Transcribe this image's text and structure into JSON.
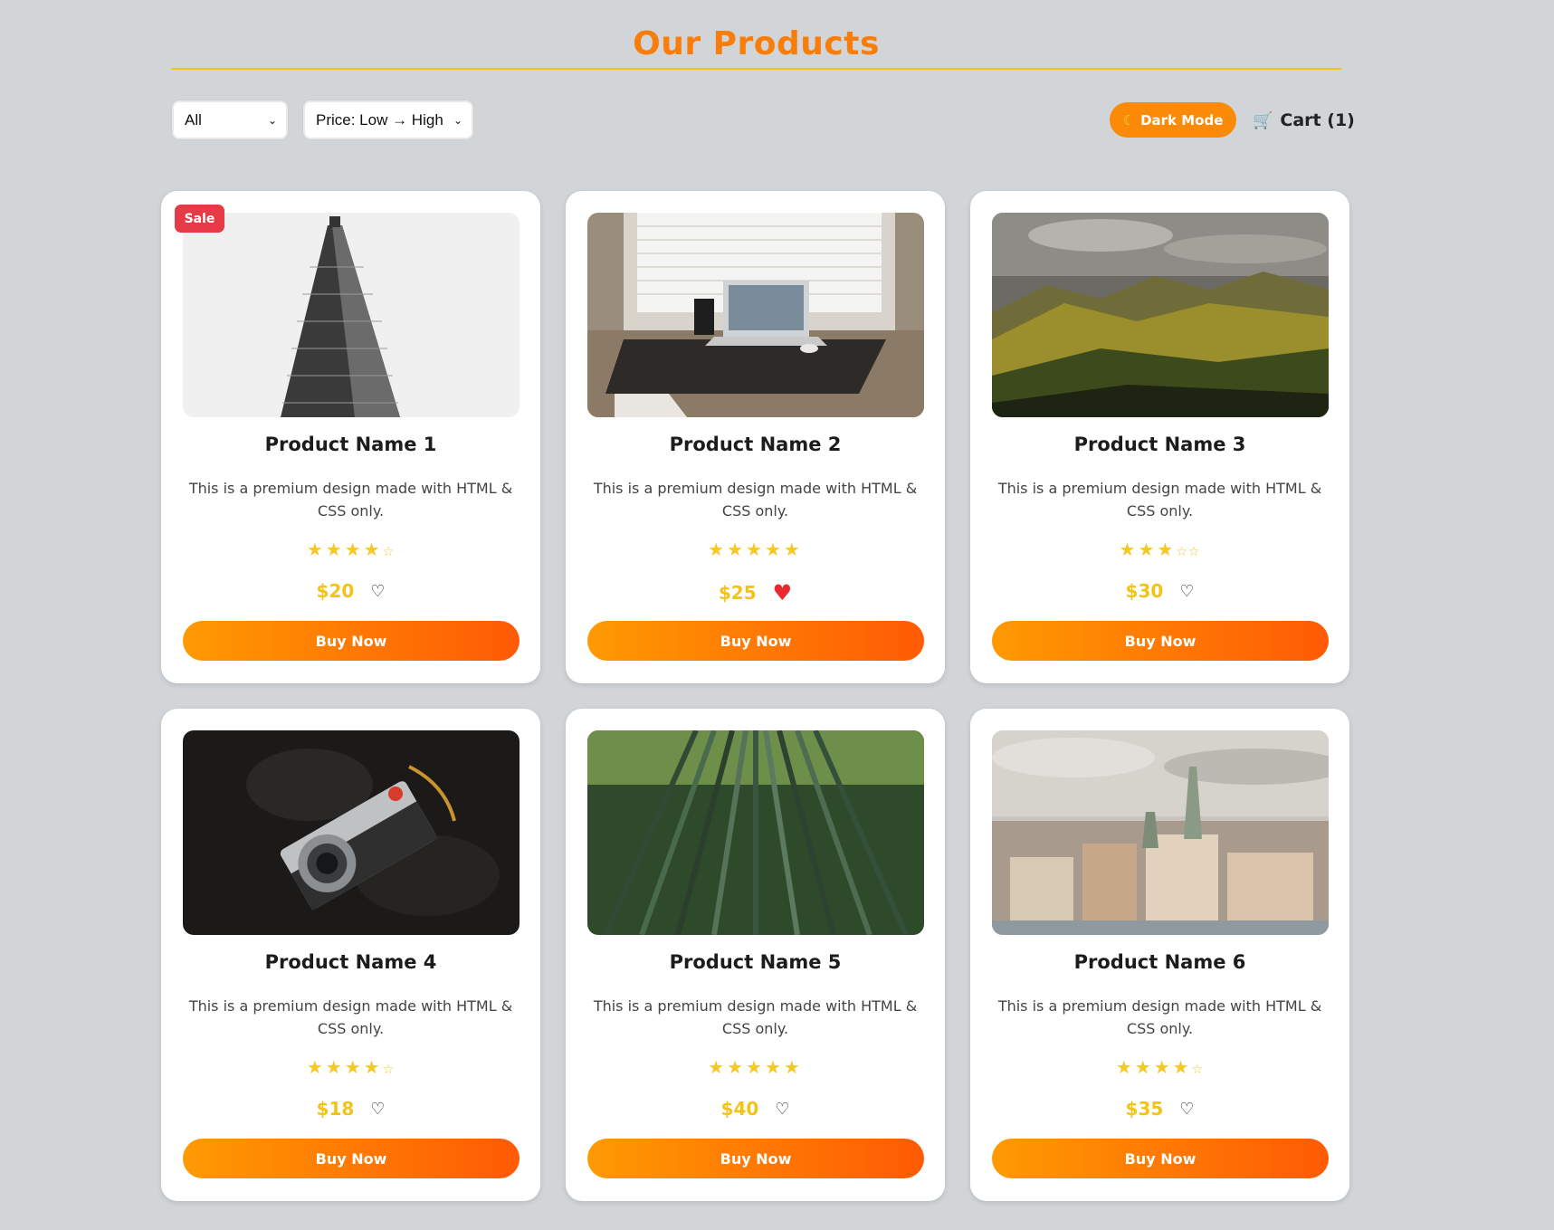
{
  "header": {
    "title": "Our Products"
  },
  "toolbar": {
    "category_value": "All",
    "sort_value": "Price: Low → High",
    "dark_mode_label": "Dark Mode",
    "cart_label": "Cart (1)"
  },
  "colors": {
    "accent": "#f97d0b",
    "price": "#f2c418",
    "sale": "#e63b47",
    "star": "#f6c825",
    "button_start": "#ff9a02",
    "button_end": "#ff5a05"
  },
  "products": [
    {
      "name": "Product Name 1",
      "desc": "This is a premium design made with HTML & CSS only.",
      "price": "$20",
      "rating": 4,
      "badge": "Sale",
      "favorite": false,
      "buy_label": "Buy Now",
      "image": "flatiron-building"
    },
    {
      "name": "Product Name 2",
      "desc": "This is a premium design made with HTML & CSS only.",
      "price": "$25",
      "rating": 5,
      "favorite": true,
      "buy_label": "Buy Now",
      "image": "laptop-desk"
    },
    {
      "name": "Product Name 3",
      "desc": "This is a premium design made with HTML & CSS only.",
      "price": "$30",
      "rating": 3,
      "favorite": false,
      "buy_label": "Buy Now",
      "image": "mountain-valley"
    },
    {
      "name": "Product Name 4",
      "desc": "This is a premium design made with HTML & CSS only.",
      "price": "$18",
      "rating": 4,
      "favorite": false,
      "buy_label": "Buy Now",
      "image": "camera"
    },
    {
      "name": "Product Name 5",
      "desc": "This is a premium design made with HTML & CSS only.",
      "price": "$40",
      "rating": 5,
      "favorite": false,
      "buy_label": "Buy Now",
      "image": "bamboo-forest"
    },
    {
      "name": "Product Name 6",
      "desc": "This is a premium design made with HTML & CSS only.",
      "price": "$35",
      "rating": 4,
      "favorite": false,
      "buy_label": "Buy Now",
      "image": "city-skyline"
    }
  ]
}
